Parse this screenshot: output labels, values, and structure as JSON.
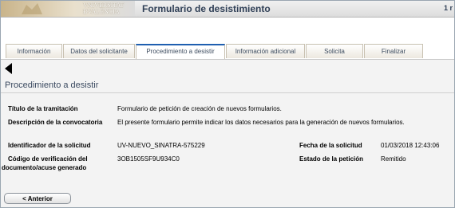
{
  "header": {
    "logo_lines": [
      "VNIVERSITAT",
      "ĐVALÈNCIA"
    ],
    "title": "Formulario de desistimiento",
    "page_indicator": "1 r"
  },
  "tabs": [
    {
      "label": "Información"
    },
    {
      "label": "Datos del solicitante"
    },
    {
      "label": "Procedimiento a desistir",
      "active": true
    },
    {
      "label": "Información adicional"
    },
    {
      "label": "Solicita"
    },
    {
      "label": "Finalizar"
    }
  ],
  "section": {
    "title": "Procedimiento a desistir"
  },
  "fields": {
    "titulo_label": "Título de la tramitación",
    "titulo_value": "Formulario de petición de creación de nuevos formularios.",
    "descripcion_label": "Descripción de la convocatoria",
    "descripcion_value": "El presente formulario permite indicar los datos necesarios para la generación de nuevos formularios.",
    "identificador_label": "Identificador de la solicitud",
    "identificador_value": "UV-NUEVO_SINATRA-575229",
    "fecha_label": "Fecha de la solicitud",
    "fecha_value": "01/03/2018 12:43:06",
    "codigo_label_line1": "Código de verificación del",
    "codigo_label_line2": "documento/acuse generado",
    "codigo_value": "3OB1505SF9U934C0",
    "estado_label": "Estado de la petición",
    "estado_value": "Remitido"
  },
  "actions": {
    "prev_label": "< Anterior"
  },
  "colors": {
    "tab_active_border": "#1f5fb0",
    "title_text": "#2f3f56",
    "panel_bg": "#f3f3f3"
  }
}
